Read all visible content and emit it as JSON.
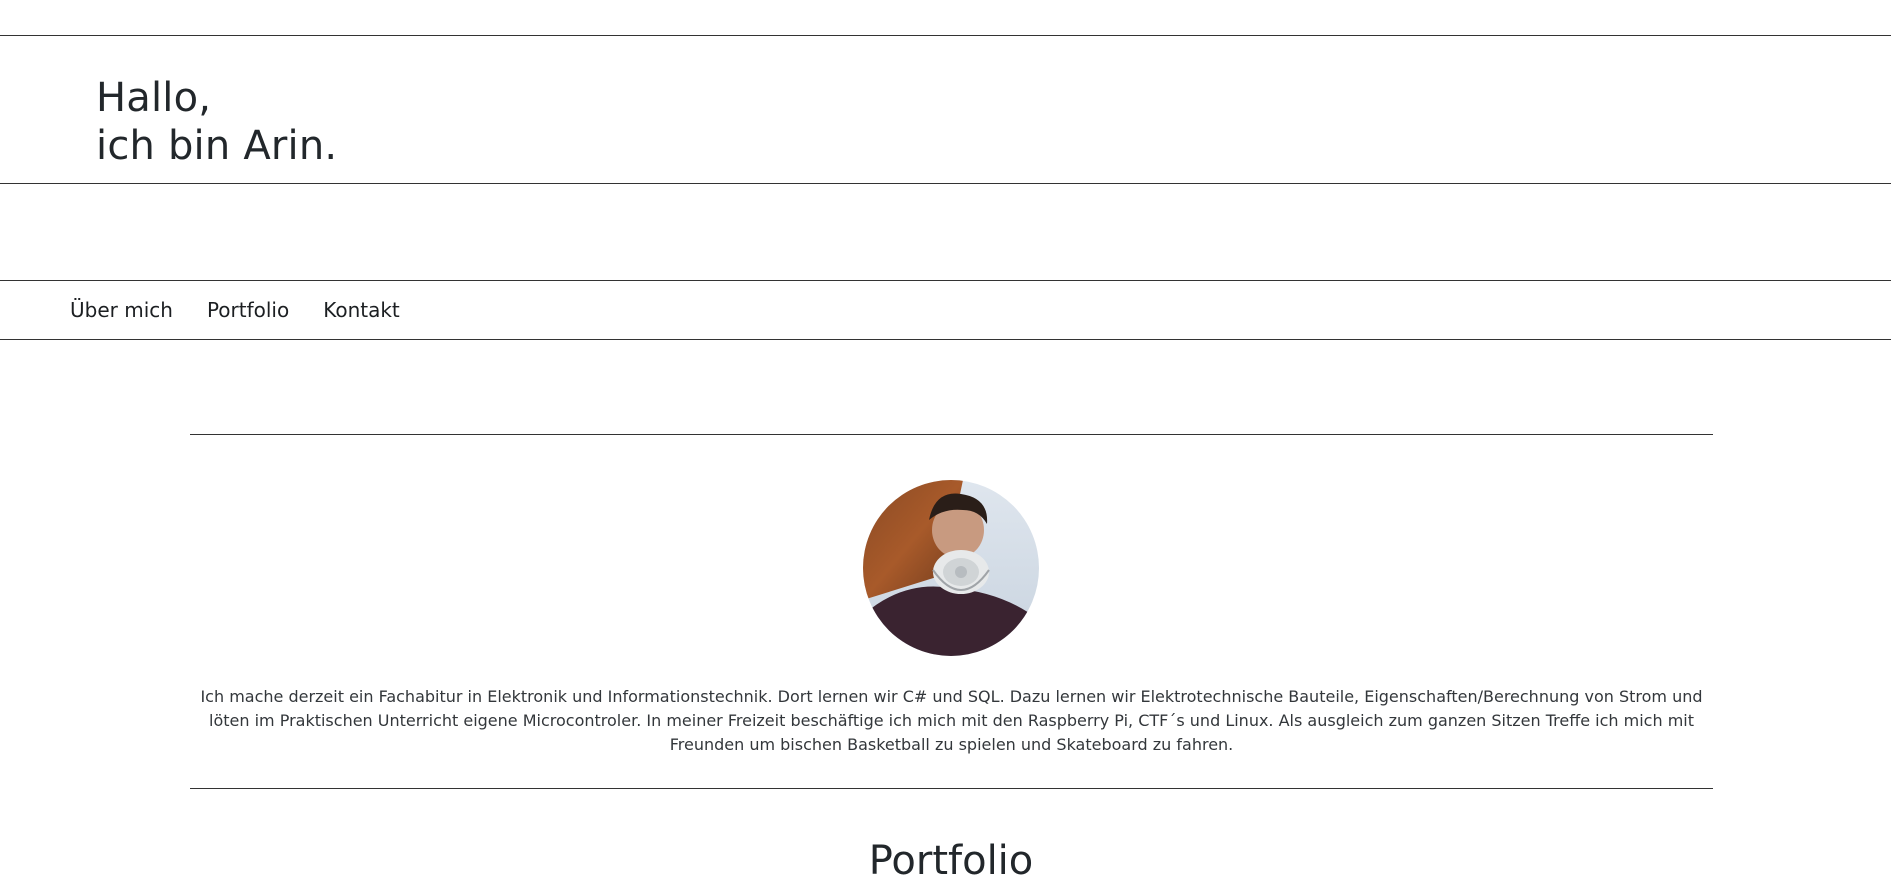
{
  "header": {
    "greeting_line1": "Hallo,",
    "greeting_line2": "ich bin Arin."
  },
  "nav": {
    "items": [
      {
        "label": "Über mich"
      },
      {
        "label": "Portfolio"
      },
      {
        "label": "Kontakt"
      }
    ]
  },
  "about": {
    "avatar_icon": "profile-photo",
    "text": "Ich mache derzeit ein Fachabitur in Elektronik und Informationstechnik. Dort lernen wir C# und SQL. Dazu lernen wir Elektrotechnische Bauteile, Eigenschaften/Berechnung von Strom und löten im Praktischen Unterricht eigene Microcontroler. In meiner Freizeit beschäftige ich mich mit den Raspberry Pi, CTF´s und Linux. Als ausgleich zum ganzen Sitzen Treffe ich mich mit Freunden um bischen Basketball zu spielen und Skateboard zu fahren."
  },
  "portfolio": {
    "title": "Portfolio"
  },
  "colors": {
    "text": "#22272b",
    "rule": "#333333",
    "background": "#ffffff"
  }
}
